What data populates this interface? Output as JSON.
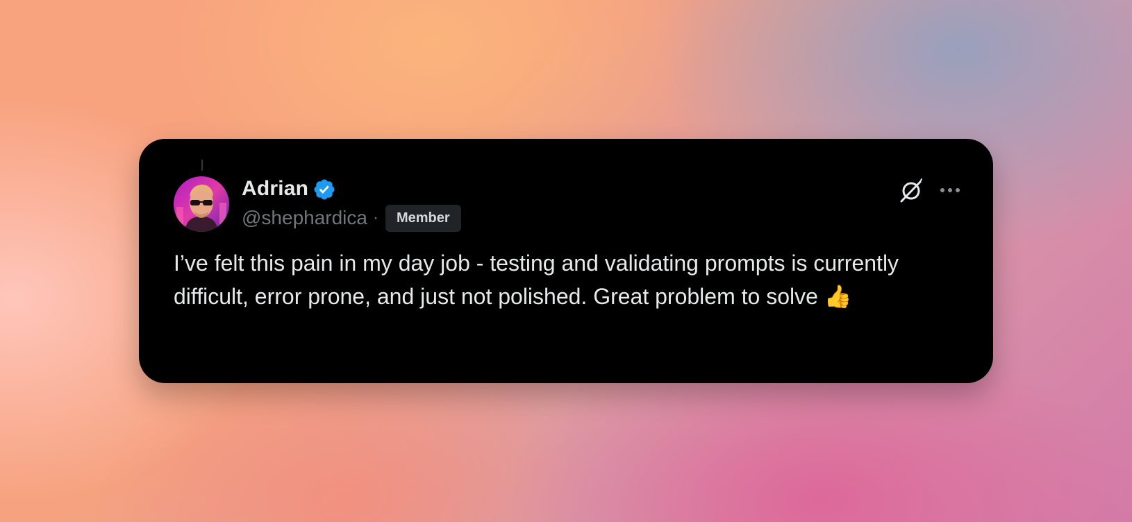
{
  "tweet": {
    "author": {
      "name": "Adrian",
      "handle": "@shephardica",
      "separator": "·",
      "badge": "Member",
      "avatar": "avatar-photo",
      "verified_icon": "verified-badge-icon",
      "verified_color": "#1d9bf0"
    },
    "actions": {
      "grok_icon": "grok-icon",
      "more_icon": "more-icon"
    },
    "text": "I’ve felt this pain in my day job - testing and validating prompts is currently difficult, error prone, and just not polished. Great problem to solve 👍",
    "colors": {
      "card_background": "#000000",
      "text": "#e7e9ea",
      "secondary_text": "#71767b",
      "badge_background": "#202327"
    }
  }
}
